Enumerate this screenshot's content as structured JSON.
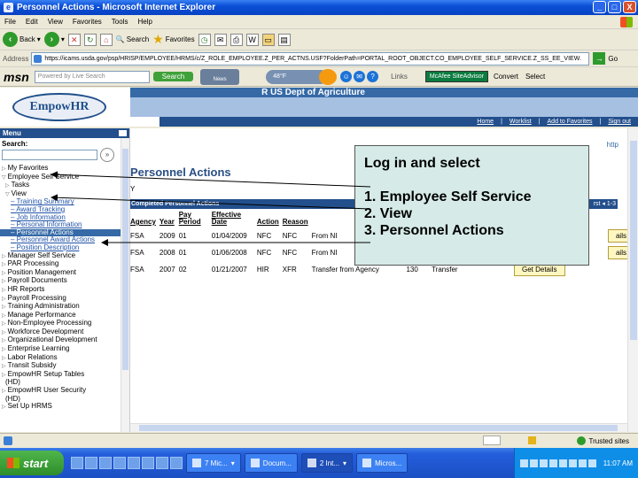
{
  "window": {
    "title": "Personnel Actions - Microsoft Internet Explorer",
    "controls": [
      "_",
      "□",
      "X"
    ]
  },
  "menubar": [
    "File",
    "Edit",
    "View",
    "Favorites",
    "Tools",
    "Help"
  ],
  "toolbar": {
    "back": "Back",
    "search": "Search",
    "favorites": "Favorites"
  },
  "address": {
    "label": "Address",
    "url": "https://icams.usda.gov/psp/HRISP/EMPLOYEE/HRMS/c/Z_ROLE_EMPLOYEE.Z_PER_ACTNS.USF?FolderPath=PORTAL_ROOT_OBJECT.CO_EMPLOYEE_SELF_SERVICE.Z_SS_EE_VIEW.",
    "go": "Go"
  },
  "msnbar": {
    "logo": "msn",
    "search_placeholder": "Powered by Live Search",
    "search_button": "Search",
    "news": "News",
    "weather": "48°F",
    "links": "Links",
    "mcafee": "McAfee SiteAdvisor",
    "convert": "Convert",
    "select": "Select"
  },
  "banner": {
    "logo_a": "EmpowHR",
    "agency": "R  US Dept of Agriculture",
    "nav": [
      "Home",
      "Worklist",
      "Add to Favorites",
      "Sign out"
    ]
  },
  "sidebar": {
    "menu_title": "Menu",
    "search_label": "Search:",
    "search_go": "»",
    "items": [
      {
        "label": "My Favorites",
        "level": 0,
        "type": "folder"
      },
      {
        "label": "Employee Self Service",
        "level": 0,
        "type": "folder-open"
      },
      {
        "label": "Tasks",
        "level": 1,
        "type": "folder"
      },
      {
        "label": "View",
        "level": 1,
        "type": "folder-open"
      },
      {
        "label": "Training Summary",
        "level": 2,
        "type": "link"
      },
      {
        "label": "Award Tracking",
        "level": 2,
        "type": "link"
      },
      {
        "label": "Job Information",
        "level": 2,
        "type": "link"
      },
      {
        "label": "Personal Information",
        "level": 2,
        "type": "link"
      },
      {
        "label": "Personnel Actions",
        "level": 2,
        "type": "selected"
      },
      {
        "label": "Personnel Award Actions",
        "level": 2,
        "type": "link"
      },
      {
        "label": "Position Description",
        "level": 2,
        "type": "link"
      },
      {
        "label": "Manager Self Service",
        "level": 0,
        "type": "folder"
      },
      {
        "label": "PAR Processing",
        "level": 0,
        "type": "folder"
      },
      {
        "label": "Position Management",
        "level": 0,
        "type": "folder"
      },
      {
        "label": "Payroll Documents",
        "level": 0,
        "type": "folder"
      },
      {
        "label": "HR Reports",
        "level": 0,
        "type": "folder"
      },
      {
        "label": "Payroll Processing",
        "level": 0,
        "type": "folder"
      },
      {
        "label": "Training Administration",
        "level": 0,
        "type": "folder"
      },
      {
        "label": "Manage Performance",
        "level": 0,
        "type": "folder"
      },
      {
        "label": "Non-Employee Processing",
        "level": 0,
        "type": "folder"
      },
      {
        "label": "Workforce Development",
        "level": 0,
        "type": "folder"
      },
      {
        "label": "Organizational Development",
        "level": 0,
        "type": "folder"
      },
      {
        "label": "Enterprise Learning",
        "level": 0,
        "type": "folder"
      },
      {
        "label": "Labor Relations",
        "level": 0,
        "type": "folder"
      },
      {
        "label": "Transit Subsidy",
        "level": 0,
        "type": "folder"
      },
      {
        "label": "EmpowHR Setup Tables",
        "level": 0,
        "type": "folder"
      },
      {
        "label": "(HD)",
        "level": 1,
        "type": "text"
      },
      {
        "label": "EmpowHR User Security",
        "level": 0,
        "type": "folder"
      },
      {
        "label": "(HD)",
        "level": 1,
        "type": "text"
      },
      {
        "label": "Set Up HRMS",
        "level": 0,
        "type": "folder"
      }
    ]
  },
  "main": {
    "heading": "Personnel Actions",
    "subline": "Y",
    "table_title": "Completed Personnel Actions",
    "pager": "rst ◂ 1-3",
    "print": "http",
    "columns": [
      "Agency",
      "Year",
      "Pay Period",
      "Effective Date",
      "Action",
      "Reason",
      "",
      "",
      "",
      ""
    ],
    "rows": [
      [
        "FSA",
        "2009",
        "01",
        "01/04/2009",
        "NFC",
        "NFC",
        "From NI",
        "",
        "",
        "Get Details"
      ],
      [
        "FSA",
        "2008",
        "01",
        "01/06/2008",
        "NFC",
        "NFC",
        "From NI",
        "",
        "",
        "Get Details"
      ],
      [
        "FSA",
        "2007",
        "02",
        "01/21/2007",
        "HIR",
        "XFR",
        "Transfer from Agency",
        "130",
        "Transfer",
        "Get Details"
      ]
    ],
    "details_visible": [
      "ails",
      "ails",
      "Get Details"
    ]
  },
  "callout": {
    "title": "Log in and select",
    "steps": [
      "1. Employee Self Service",
      "2. View",
      "3. Personnel Actions"
    ]
  },
  "statusbar": {
    "zone": "Trusted sites"
  },
  "taskbar": {
    "start": "start",
    "buttons": [
      "7 Mic...",
      "Docum...",
      "2 Int...",
      "Micros..."
    ],
    "clock": "11:07 AM"
  }
}
